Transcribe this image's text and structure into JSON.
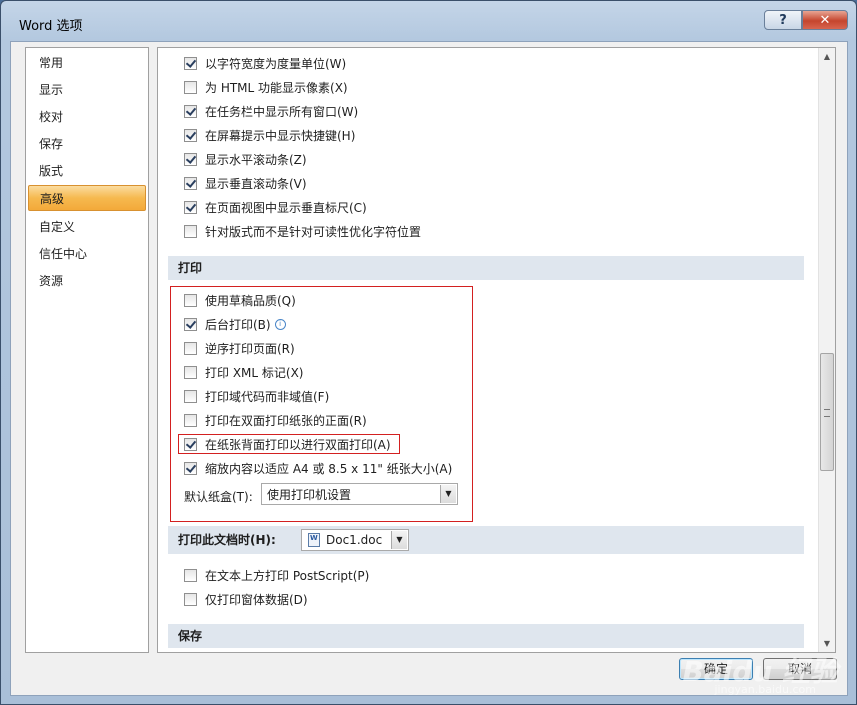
{
  "window": {
    "title": "Word 选项",
    "help_label": "?",
    "close_label": "✕"
  },
  "nav": {
    "items": [
      "常用",
      "显示",
      "校对",
      "保存",
      "版式",
      "高级",
      "自定义",
      "信任中心",
      "资源"
    ],
    "selected": "高级"
  },
  "display_options": [
    {
      "label": "以字符宽度为度量单位(W)",
      "checked": true
    },
    {
      "label": "为 HTML 功能显示像素(X)",
      "checked": false
    },
    {
      "label": "在任务栏中显示所有窗口(W)",
      "checked": true
    },
    {
      "label": "在屏幕提示中显示快捷键(H)",
      "checked": true
    },
    {
      "label": "显示水平滚动条(Z)",
      "checked": true
    },
    {
      "label": "显示垂直滚动条(V)",
      "checked": true
    },
    {
      "label": "在页面视图中显示垂直标尺(C)",
      "checked": true
    },
    {
      "label": "针对版式而不是针对可读性优化字符位置",
      "checked": false
    }
  ],
  "print_section": {
    "title": "打印",
    "options": [
      {
        "label": "使用草稿品质(Q)",
        "checked": false
      },
      {
        "label": "后台打印(B)",
        "checked": true
      },
      {
        "label": "逆序打印页面(R)",
        "checked": false
      },
      {
        "label": "打印 XML 标记(X)",
        "checked": false
      },
      {
        "label": "打印域代码而非域值(F)",
        "checked": false
      },
      {
        "label": "打印在双面打印纸张的正面(R)",
        "checked": false
      },
      {
        "label": "在纸张背面打印以进行双面打印(A)",
        "checked": true
      },
      {
        "label": "缩放内容以适应 A4 或 8.5 x 11\" 纸张大小(A)",
        "checked": true
      }
    ],
    "tray_label": "默认纸盒(T):",
    "tray_value": "使用打印机设置"
  },
  "print_doc_section": {
    "title": "打印此文档时(H):",
    "doc_value": "Doc1.doc",
    "options": [
      {
        "label": "在文本上方打印 PostScript(P)",
        "checked": false
      },
      {
        "label": "仅打印窗体数据(D)",
        "checked": false
      }
    ]
  },
  "save_section": {
    "title": "保存"
  },
  "buttons": {
    "ok": "确定",
    "cancel": "取消"
  },
  "watermark": {
    "brand": "Baidu 经验",
    "url": "jingyan.baidu.com"
  },
  "colors": {
    "highlight_box": "#d32020",
    "nav_selected": "#f6b94f"
  }
}
